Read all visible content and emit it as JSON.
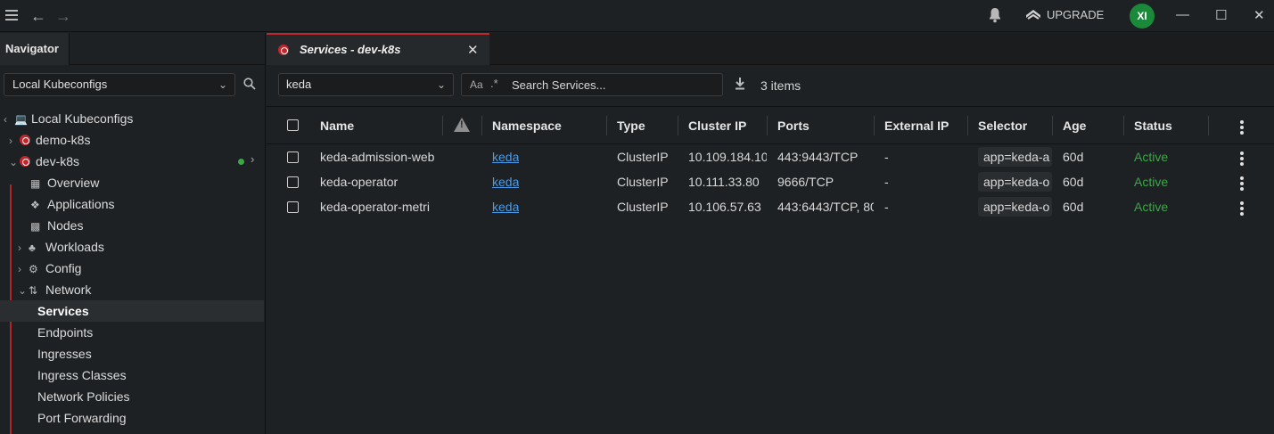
{
  "titlebar": {
    "upgrade_label": "UPGRADE",
    "avatar_initials": "XI",
    "avatar_color": "#1a8a3a"
  },
  "sidebar": {
    "tab_label": "Navigator",
    "kubeconfig_select": "Local Kubeconfigs",
    "tree": {
      "root": "Local Kubeconfigs",
      "clusters": [
        "demo-k8s",
        "dev-k8s"
      ],
      "items": {
        "overview": "Overview",
        "applications": "Applications",
        "nodes": "Nodes",
        "workloads": "Workloads",
        "config": "Config",
        "network": "Network",
        "services": "Services",
        "endpoints": "Endpoints",
        "ingresses": "Ingresses",
        "ingress_classes": "Ingress Classes",
        "network_policies": "Network Policies",
        "port_forwarding": "Port Forwarding"
      }
    }
  },
  "main": {
    "tab_title": "Services - dev-k8s",
    "namespace_select": "keda",
    "search": {
      "case_label": "Aa",
      "regex_label": ".*",
      "placeholder": "Search Services..."
    },
    "item_count": "3 items",
    "columns": {
      "name": "Name",
      "namespace": "Namespace",
      "type": "Type",
      "cluster_ip": "Cluster IP",
      "ports": "Ports",
      "external_ip": "External IP",
      "selector": "Selector",
      "age": "Age",
      "status": "Status"
    },
    "rows": [
      {
        "name": "keda-admission-web",
        "namespace": "keda",
        "type": "ClusterIP",
        "cluster_ip": "10.109.184.10",
        "ports": "443:9443/TCP",
        "external_ip": "-",
        "selector": "app=keda-a",
        "age": "60d",
        "status": "Active"
      },
      {
        "name": "keda-operator",
        "namespace": "keda",
        "type": "ClusterIP",
        "cluster_ip": "10.111.33.80",
        "ports": "9666/TCP",
        "external_ip": "-",
        "selector": "app=keda-o",
        "age": "60d",
        "status": "Active"
      },
      {
        "name": "keda-operator-metri",
        "namespace": "keda",
        "type": "ClusterIP",
        "cluster_ip": "10.106.57.63",
        "ports": "443:6443/TCP, 80",
        "external_ip": "-",
        "selector": "app=keda-o",
        "age": "60d",
        "status": "Active"
      }
    ],
    "colors": {
      "accent": "#c0272d",
      "link": "#4a9be8",
      "status_active": "#3aa845"
    }
  }
}
